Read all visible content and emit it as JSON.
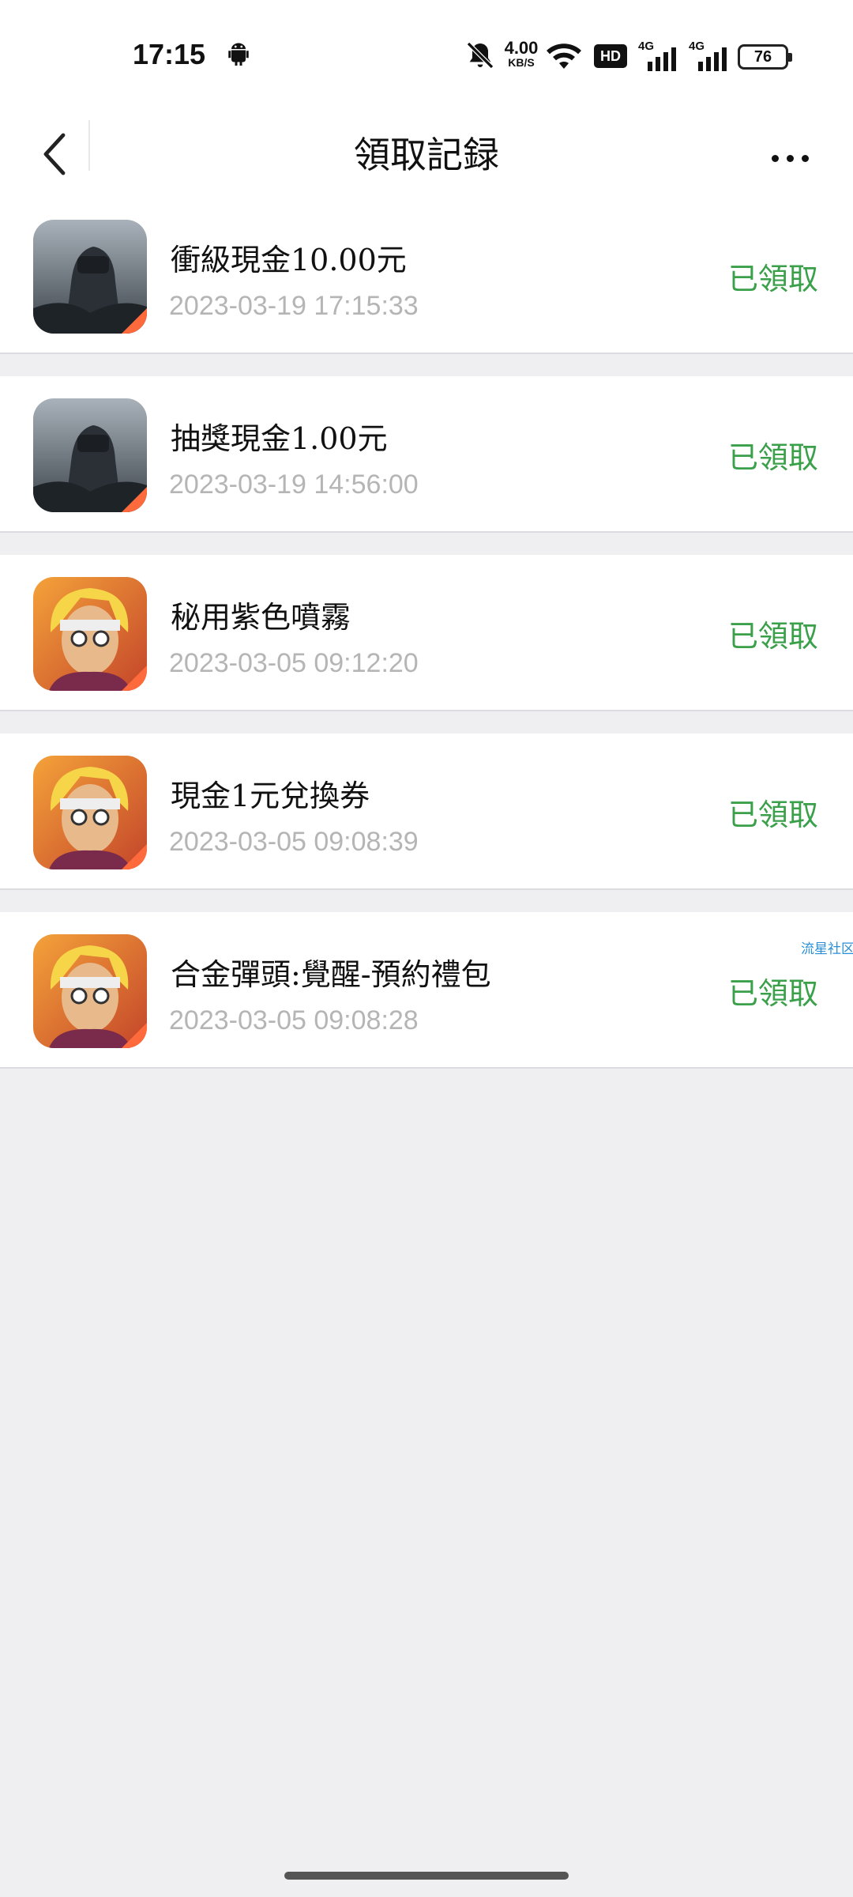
{
  "status_bar": {
    "time": "17:15",
    "net_speed_value": "4.00",
    "net_speed_unit": "KB/S",
    "hd_label": "HD",
    "signal_1": "4G",
    "signal_2": "4G",
    "battery": "76",
    "icons": [
      "android-icon",
      "bell-muted-icon",
      "wifi-icon",
      "signal-icon",
      "battery-icon"
    ]
  },
  "header": {
    "title": "領取記録",
    "back_icon": "chevron-left-icon",
    "more_icon": "more-dots-icon"
  },
  "records": [
    {
      "title": "衝級現金10.00元",
      "time": "2023-03-19 17:15:33",
      "status": "已領取",
      "icon": "soldier-game-icon"
    },
    {
      "title": "抽獎現金1.00元",
      "time": "2023-03-19 14:56:00",
      "status": "已領取",
      "icon": "soldier-game-icon"
    },
    {
      "title": "秘用紫色噴霧",
      "time": "2023-03-05 09:12:20",
      "status": "已領取",
      "icon": "blonde-hero-game-icon"
    },
    {
      "title": "現金1元兌換券",
      "time": "2023-03-05 09:08:39",
      "status": "已領取",
      "icon": "blonde-hero-game-icon"
    },
    {
      "title": "合金彈頭:覺醒-預約禮包",
      "time": "2023-03-05 09:08:28",
      "status": "已領取",
      "icon": "blonde-hero-game-icon"
    }
  ],
  "tag": "流星社区",
  "colors": {
    "status_green": "#3aa04a",
    "time_gray": "#b5b5b5",
    "tag_blue": "#2a8fd6",
    "background": "#efeff2"
  }
}
